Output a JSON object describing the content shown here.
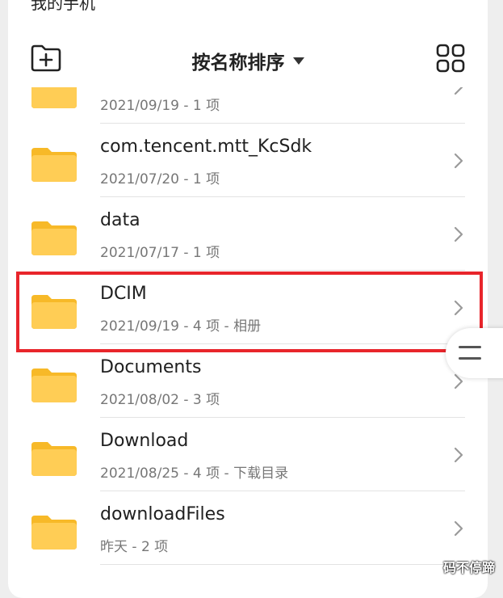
{
  "header": {
    "title": "我的手机"
  },
  "toolbar": {
    "new_folder_icon": "folder-plus-icon",
    "sort_label": "按名称排序",
    "view_toggle_icon": "grid-view-icon"
  },
  "files": [
    {
      "name": "",
      "meta": "2021/09/19 - 1 项"
    },
    {
      "name": "com.tencent.mtt_KcSdk",
      "meta": "2021/07/20 - 1 项"
    },
    {
      "name": "data",
      "meta": "2021/07/17 - 1 项"
    },
    {
      "name": "DCIM",
      "meta": "2021/09/19 - 4 项 - 相册"
    },
    {
      "name": "Documents",
      "meta": "2021/08/02 - 3 项"
    },
    {
      "name": "Download",
      "meta": "2021/08/25 - 4 项 - 下载目录"
    },
    {
      "name": "downloadFiles",
      "meta": "昨天 - 2 项"
    }
  ],
  "watermark": "码不停蹄",
  "colors": {
    "folder": "#ffcd55",
    "folder_tab": "#f7b928",
    "highlight": "#e8252b"
  }
}
